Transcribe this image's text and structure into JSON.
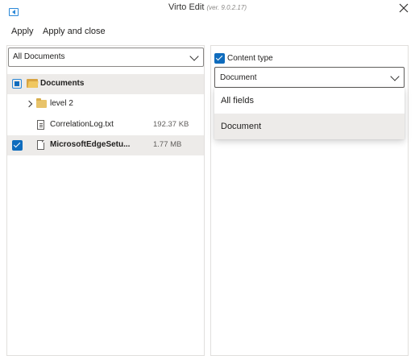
{
  "window": {
    "title": "Virto Edit",
    "version": "(ver. 9.0.2.17)"
  },
  "toolbar": {
    "apply_label": "Apply",
    "apply_close_label": "Apply and close"
  },
  "library": {
    "selected": "All Documents"
  },
  "tree": {
    "root": {
      "label": "Documents",
      "checked": "partial"
    },
    "items": [
      {
        "label": "level 2",
        "type": "folder",
        "size": ""
      },
      {
        "label": "CorrelationLog.txt",
        "type": "text-file",
        "size": "192.37 KB"
      },
      {
        "label": "MicrosoftEdgeSetu...",
        "type": "file",
        "size": "1.77 MB",
        "checked": true
      }
    ]
  },
  "fields": {
    "content_type_label": "Content type",
    "content_type_checked": true,
    "content_type_value": "Document",
    "options": [
      "All fields",
      "Document"
    ],
    "highlighted_option": "Document"
  },
  "colors": {
    "accent": "#0f6cbd",
    "selection": "#edebe9",
    "border": "#e1dfdd"
  },
  "icons": {
    "back": "back-panel-icon",
    "close": "close-icon",
    "chevron": "chevron-down-icon",
    "folder": "folder-icon",
    "file": "file-icon"
  }
}
